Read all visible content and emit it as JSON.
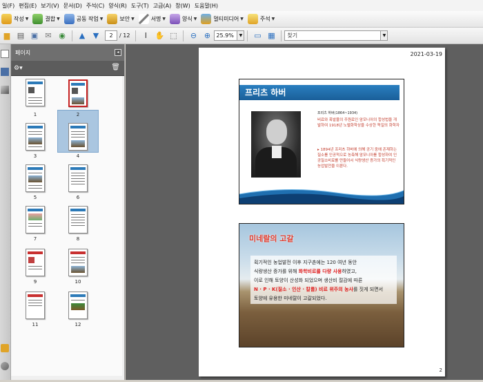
{
  "menu": [
    "일(F)",
    "편집(E)",
    "보기(V)",
    "문서(D)",
    "주석(C)",
    "양식(R)",
    "도구(T)",
    "고급(A)",
    "창(W)",
    "도움말(H)"
  ],
  "toolbar1": {
    "create": "작성",
    "combine": "결합",
    "collaborate": "공동 작업",
    "secure": "보안",
    "sign": "서명",
    "forms": "양식",
    "multimedia": "멀티미디어",
    "comment": "주석"
  },
  "toolbar2": {
    "page_current": "2",
    "page_total": "/ 12",
    "zoom": "25.9%",
    "find_placeholder": "찾기"
  },
  "panel": {
    "title": "페이지",
    "thumb_labels": [
      "1",
      "2",
      "3",
      "4",
      "5",
      "6",
      "7",
      "8",
      "9",
      "10",
      "11",
      "12"
    ],
    "selected": "2"
  },
  "document": {
    "date": "2021-03-19",
    "page_number": "2",
    "slide1": {
      "title": "프리츠 하버",
      "name": "프리츠 하버(1864~1934)",
      "desc": "비료와 폭발물의 주원료인 암모니아의 합성법을 개발하여 1918년 노벨화학상을 수상한 독일의 화학자",
      "bullet": "▸ 1894년 프리츠 하버에 의해 공기 중에 존재하는 질소를 인공적으로 농축해 암모니아를 합성하여 인공질소비료를 만들어서 식량생산 증가의 획기적인 농업발전을 이룬다."
    },
    "slide2": {
      "title": "미네랄의 고갈",
      "line1": "획기적인 농업발전 이후 지구촌에는 120 여년 동안",
      "line2a": "식량생산 증가를 위해 ",
      "line2b": "화학비료를 다량 사용",
      "line2c": "하였고,",
      "line3": "이로 인해 토양이 산성화 되었으며 생산비 절감에 따른",
      "line4a": "N · P · K(질소 · 인산 · 칼륨) 비료 위주의 농사",
      "line4b": "를 짓게 되면서",
      "line5": "토양에 유용한 미네랄이 고갈되었다."
    }
  }
}
